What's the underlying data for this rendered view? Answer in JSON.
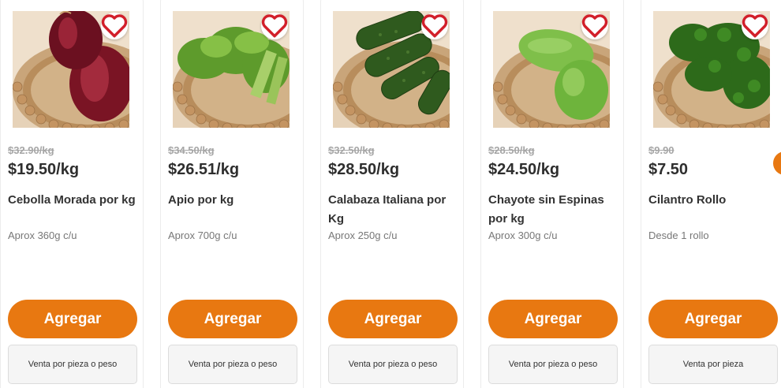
{
  "theme": {
    "accent": "#e87811"
  },
  "products": [
    {
      "image_icon": "red-onion-basket-photo",
      "old_price": "$32.90/kg",
      "price": "$19.50/kg",
      "name": "Cebolla Morada por kg",
      "desc": "Aprox 360g c/u",
      "add_label": "Agregar",
      "sale_label": "Venta por pieza o peso"
    },
    {
      "image_icon": "celery-basket-photo",
      "old_price": "$34.50/kg",
      "price": "$26.51/kg",
      "name": "Apio por kg",
      "desc": "Aprox 700g c/u",
      "add_label": "Agregar",
      "sale_label": "Venta por pieza o peso"
    },
    {
      "image_icon": "zucchini-basket-photo",
      "old_price": "$32.50/kg",
      "price": "$28.50/kg",
      "name": "Calabaza Italiana por Kg",
      "desc": "Aprox 250g c/u",
      "add_label": "Agregar",
      "sale_label": "Venta por pieza o peso"
    },
    {
      "image_icon": "chayote-basket-photo",
      "old_price": "$28.50/kg",
      "price": "$24.50/kg",
      "name": "Chayote sin Espinas por kg",
      "desc": "Aprox 300g c/u",
      "add_label": "Agregar",
      "sale_label": "Venta por pieza o peso"
    },
    {
      "image_icon": "cilantro-basket-photo",
      "old_price": "$9.90",
      "price": "$7.50",
      "name": "Cilantro Rollo",
      "desc": "Desde 1 rollo",
      "add_label": "Agregar",
      "sale_label": "Venta por pieza"
    }
  ]
}
